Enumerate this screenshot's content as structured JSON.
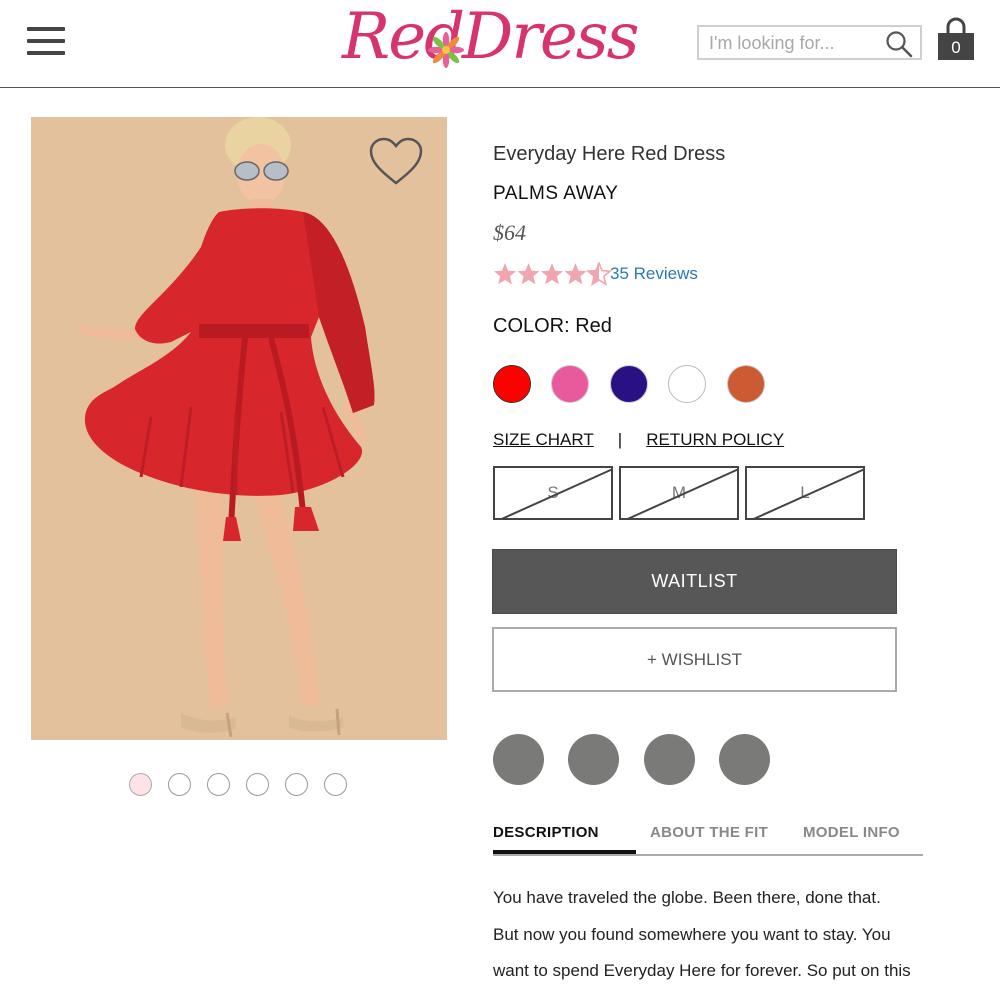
{
  "header": {
    "logo_word_1": "Red",
    "logo_word_2": "Dress",
    "search_placeholder": "I'm looking for...",
    "cart_count": "0"
  },
  "gallery": {
    "dots": 6,
    "active_dot": 0
  },
  "product": {
    "title": "Everyday Here Red Dress",
    "brand": "PALMS AWAY",
    "price": "$64",
    "rating": 4.5,
    "reviews_label": "35 Reviews",
    "color_label": "COLOR: Red",
    "colors": [
      "#ff0000",
      "#e85a9c",
      "#2a1183",
      "#ffffff",
      "#cc5a32"
    ],
    "size_chart_label": "SIZE CHART",
    "divider": "|",
    "return_policy_label": "RETURN POLICY",
    "sizes": [
      "S",
      "M",
      "L"
    ],
    "waitlist_label": "WAITLIST",
    "wishlist_label": "+ WISHLIST"
  },
  "tabs": {
    "description": "DESCRIPTION",
    "about_fit": "ABOUT THE FIT",
    "model_info": "MODEL INFO"
  },
  "description_lines": [
    "You have traveled the globe. Been there, done that.",
    "But now you found somewhere you want to stay. You",
    "want to spend Everyday Here for forever. So put on this"
  ],
  "colors": {
    "brand": "#d6336f",
    "link": "#2a78b6",
    "star": "#f0a6ae",
    "button_dark": "#575757",
    "social_circle": "#7a7a78"
  }
}
